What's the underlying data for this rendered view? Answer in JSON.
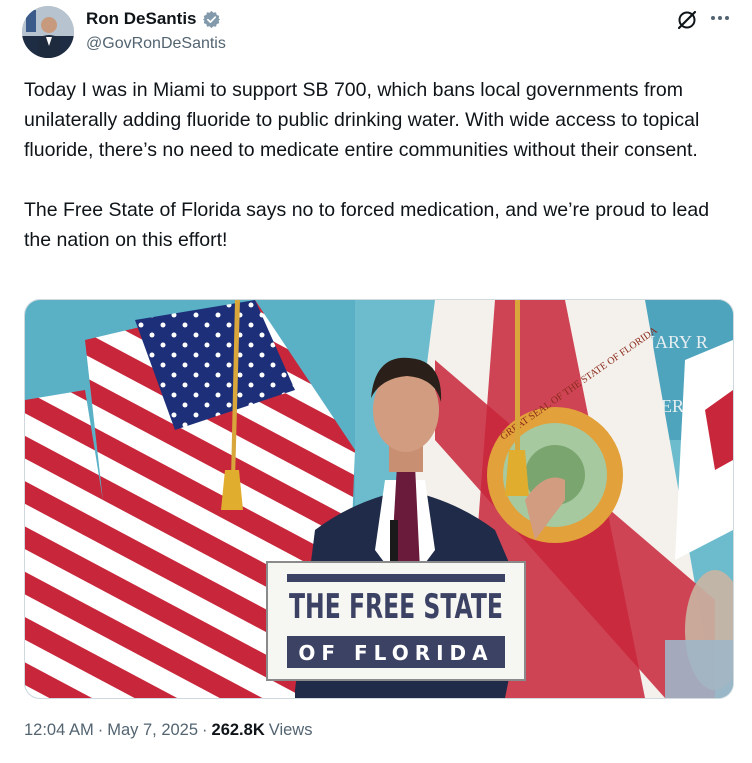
{
  "author": {
    "display_name": "Ron DeSantis",
    "handle": "@GovRonDeSantis",
    "verified_icon": "government-verified-badge"
  },
  "actions": {
    "grok_icon": "grok-slash-icon",
    "more_icon": "more-horizontal-icon"
  },
  "post": {
    "paragraphs": [
      "Today I was in Miami to support SB 700, which bans local governments from unilaterally adding fluoride to public drinking water. With wide access to topical fluoride, there’s no need to medicate entire communities without their consent.",
      "The Free State of Florida says no to forced medication, and we’re proud to lead the nation on this effort!"
    ]
  },
  "media": {
    "podium_line1": "THE FREE STATE",
    "podium_line2": "OF FLORIDA",
    "seal_text": "GREAT SEAL OF THE STATE OF FLORIDA",
    "wall_text_1": "SSIONARY R",
    "wall_text_2": "THERN"
  },
  "meta": {
    "time": "12:04 AM",
    "separator": "·",
    "date": "May 7, 2025",
    "views_count": "262.8K",
    "views_label": "Views"
  },
  "colors": {
    "text_primary": "#0f1419",
    "text_secondary": "#536471",
    "verified_gray": "#829aab"
  }
}
